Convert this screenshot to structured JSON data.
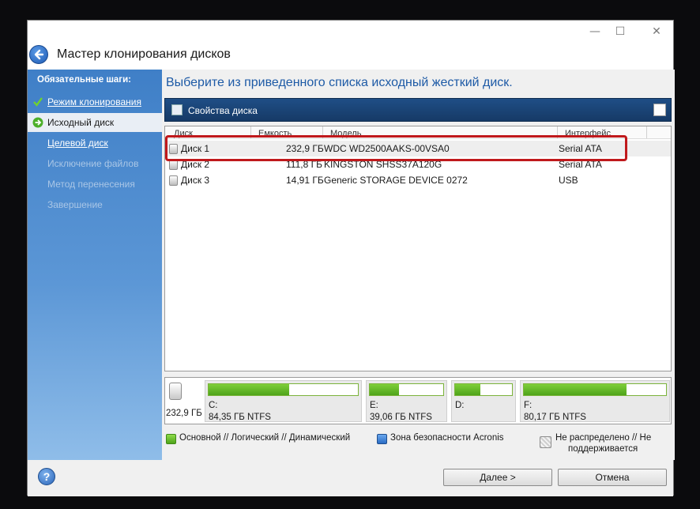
{
  "window": {
    "title": "Мастер клонирования дисков",
    "controls": {
      "minimize": "—",
      "maximize": "☐",
      "close": "✕"
    }
  },
  "sidebar": {
    "heading": "Обязательные шаги:",
    "items": [
      {
        "label": "Режим клонирования",
        "state": "done"
      },
      {
        "label": "Исходный диск",
        "state": "current"
      },
      {
        "label": "Целевой диск",
        "state": "next"
      },
      {
        "label": "Исключение файлов",
        "state": "disabled"
      },
      {
        "label": "Метод перенесения",
        "state": "disabled"
      },
      {
        "label": "Завершение",
        "state": "disabled"
      }
    ]
  },
  "main": {
    "instruction": "Выберите из приведенного списка исходный жесткий диск.",
    "toolbar_label": "Свойства диска"
  },
  "disk_table": {
    "columns": [
      "Диск",
      "Емкость",
      "Модель",
      "Интерфейс"
    ],
    "rows": [
      {
        "disk": "Диск 1",
        "capacity": "232,9 ГБ",
        "model": "WDC WD2500AAKS-00VSA0",
        "interface": "Serial ATA",
        "selected": true
      },
      {
        "disk": "Диск 2",
        "capacity": "111,8 ГБ",
        "model": "KINGSTON SHSS37A120G",
        "interface": "Serial ATA",
        "selected": false
      },
      {
        "disk": "Диск 3",
        "capacity": "14,91 ГБ",
        "model": "Generic STORAGE DEVICE 0272",
        "interface": "USB",
        "selected": false
      }
    ]
  },
  "disk_map": {
    "size": "232,9 ГБ",
    "partitions": [
      {
        "letter": "C:",
        "info": "84,35 ГБ  NTFS",
        "used_fraction": 0.54
      },
      {
        "letter": "E:",
        "info": "39,06 ГБ  NTFS",
        "used_fraction": 0.4
      },
      {
        "letter": "D:",
        "info": "",
        "used_fraction": 0.45
      },
      {
        "letter": "F:",
        "info": "80,17 ГБ  NTFS",
        "used_fraction": 0.72
      }
    ]
  },
  "legend": {
    "primary": "Основной // Логический // Динамический",
    "acronis": "Зона безопасности Acronis",
    "unallocated_line1": "Не распределено // Не",
    "unallocated_line2": "поддерживается"
  },
  "buttons": {
    "next_underlined": "Д",
    "next_rest": "алее >",
    "cancel": "Отмена",
    "help": "?"
  },
  "colors": {
    "accent": "#1d5aa6",
    "selection_highlight": "#c0191c",
    "partition_fill": "#5fb82a",
    "acronis_zone": "#3a7fd6"
  }
}
